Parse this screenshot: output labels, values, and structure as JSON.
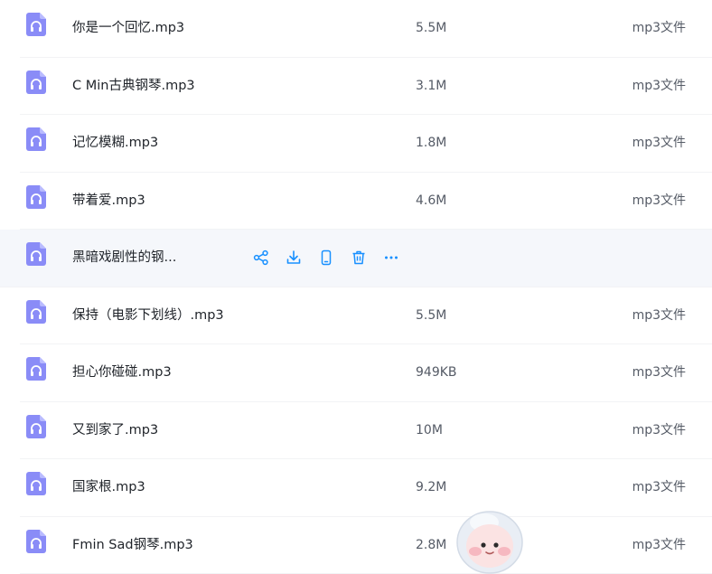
{
  "files": [
    {
      "name": "你是一个回忆.mp3",
      "size": "5.5M",
      "type": "mp3文件"
    },
    {
      "name": "C Min古典钢琴.mp3",
      "size": "3.1M",
      "type": "mp3文件"
    },
    {
      "name": "记忆模糊.mp3",
      "size": "1.8M",
      "type": "mp3文件"
    },
    {
      "name": "带着爱.mp3",
      "size": "4.6M",
      "type": "mp3文件"
    },
    {
      "name": "黑暗戏剧性的钢...",
      "size": "",
      "type": ""
    },
    {
      "name": "保持（电影下划线）.mp3",
      "size": "5.5M",
      "type": "mp3文件"
    },
    {
      "name": "担心你碰碰.mp3",
      "size": "949KB",
      "type": "mp3文件"
    },
    {
      "name": "又到家了.mp3",
      "size": "10M",
      "type": "mp3文件"
    },
    {
      "name": "国家根.mp3",
      "size": "9.2M",
      "type": "mp3文件"
    },
    {
      "name": "Fmin Sad钢琴.mp3",
      "size": "2.8M",
      "type": "mp3文件"
    }
  ],
  "hover_row_index": 4,
  "row_actions": [
    "share-icon",
    "download-icon",
    "phone-icon",
    "trash-icon",
    "more-icon"
  ],
  "colors": {
    "icon_purple": "#8a8cf7",
    "action_blue": "#1890ff",
    "hover_bg": "#f5f7fb"
  }
}
